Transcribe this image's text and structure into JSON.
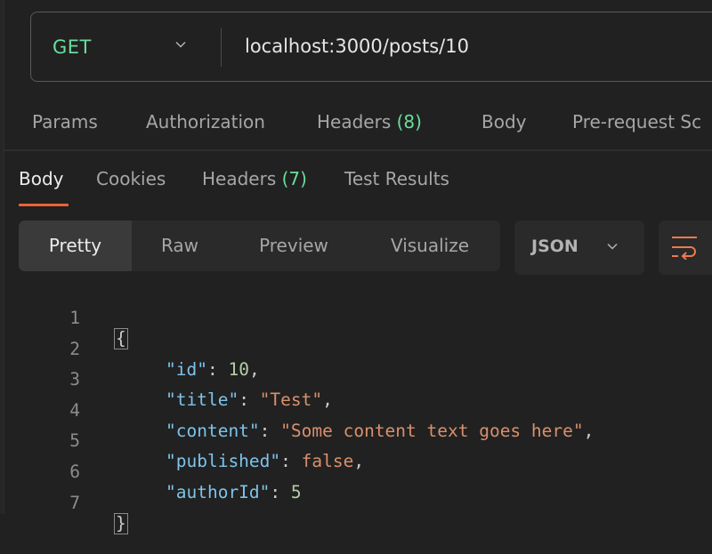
{
  "request": {
    "method": "GET",
    "method_color": "#6bdd9a",
    "url": "localhost:3000/posts/10"
  },
  "request_tabs": [
    {
      "label": "Params"
    },
    {
      "label": "Authorization"
    },
    {
      "label": "Headers",
      "count": "(8)"
    },
    {
      "label": "Body"
    },
    {
      "label": "Pre-request Sc"
    }
  ],
  "response_tabs": [
    {
      "label": "Body",
      "active": true
    },
    {
      "label": "Cookies"
    },
    {
      "label": "Headers",
      "count": "(7)"
    },
    {
      "label": "Test Results"
    }
  ],
  "view_modes": [
    {
      "label": "Pretty",
      "selected": true
    },
    {
      "label": "Raw"
    },
    {
      "label": "Preview"
    },
    {
      "label": "Visualize"
    }
  ],
  "format": {
    "selected": "JSON"
  },
  "icons": {
    "method_dropdown": "chevron-down-icon",
    "format_dropdown": "chevron-down-icon",
    "wrap": "wrap-lines-icon"
  },
  "colors": {
    "accent": "#ee6235",
    "count": "#6bdd9a"
  },
  "code": {
    "line_numbers": [
      "1",
      "2",
      "3",
      "4",
      "5",
      "6",
      "7"
    ],
    "open_brace": "{",
    "close_brace": "}",
    "fields": [
      {
        "key": "\"id\"",
        "value": "10",
        "type": "num",
        "trail": ","
      },
      {
        "key": "\"title\"",
        "value": "\"Test\"",
        "type": "str",
        "trail": ","
      },
      {
        "key": "\"content\"",
        "value": "\"Some content text goes here\"",
        "type": "str",
        "trail": ","
      },
      {
        "key": "\"published\"",
        "value": "false",
        "type": "bool",
        "trail": ","
      },
      {
        "key": "\"authorId\"",
        "value": "5",
        "type": "num",
        "trail": ""
      }
    ]
  }
}
